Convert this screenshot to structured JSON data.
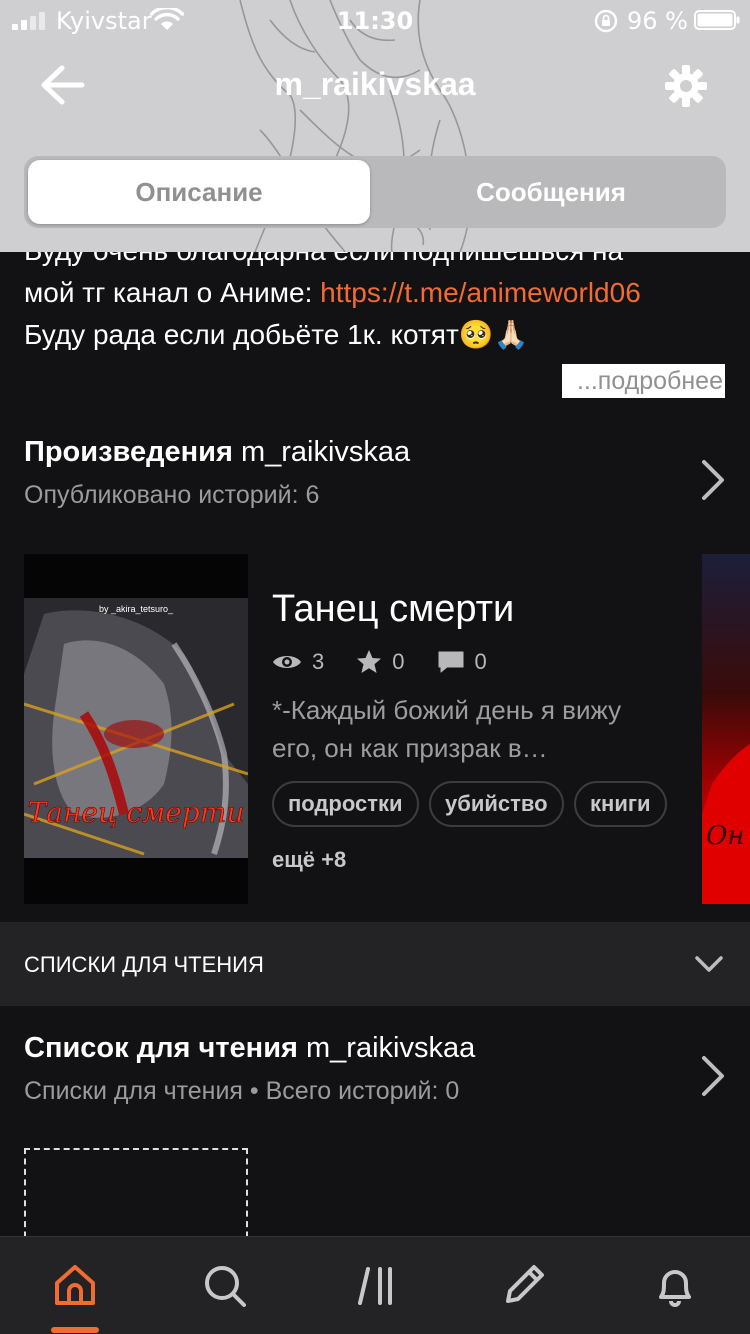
{
  "status_bar": {
    "carrier": "Kyivstar",
    "time": "11:30",
    "battery": "96 %"
  },
  "header": {
    "title": "m_raikivskaa",
    "tabs": [
      {
        "label": "Описание",
        "active": true
      },
      {
        "label": "Сообщения",
        "active": false
      }
    ]
  },
  "description": {
    "line1": "Буду очень благодарна если подпишешься на",
    "line2_prefix": "мой тг канал о Аниме: ",
    "link": "https://t.me/animeworld06",
    "line3": "Буду рада если добьёте 1к. котят",
    "emoji": "🥺🙏🏻",
    "more": "...подробнее"
  },
  "works": {
    "title": "Произведения",
    "user": "m_raikivskaa",
    "subtitle": "Опубликовано историй: 6",
    "story": {
      "title": "Танец смерти",
      "views": "3",
      "votes": "0",
      "comments": "0",
      "excerpt": "*-Каждый божий день я вижу его, он как призрак в…",
      "tags": [
        "подростки",
        "убийство",
        "книги"
      ],
      "more_tags": "ещё +8",
      "cover_author": "by _akira_tetsuro_",
      "cover_title": "Танец смерти",
      "next_cover_text": "Он"
    }
  },
  "reading_lists": {
    "section_label": "СПИСКИ ДЛЯ ЧТЕНИЯ",
    "title": "Список для чтения",
    "user": "m_raikivskaa",
    "subtitle": "Списки для чтения • Всего историй: 0"
  },
  "tabbar": {
    "items": [
      {
        "icon": "home-icon",
        "active": true
      },
      {
        "icon": "search-icon",
        "active": false
      },
      {
        "icon": "library-icon",
        "active": false
      },
      {
        "icon": "write-pencil-icon",
        "active": false
      },
      {
        "icon": "bell-icon",
        "active": false
      }
    ],
    "accent": "#f26b32"
  },
  "colors": {
    "background": "#121214",
    "accent": "#f26b32",
    "header_overlay": "#cfcfd1"
  }
}
